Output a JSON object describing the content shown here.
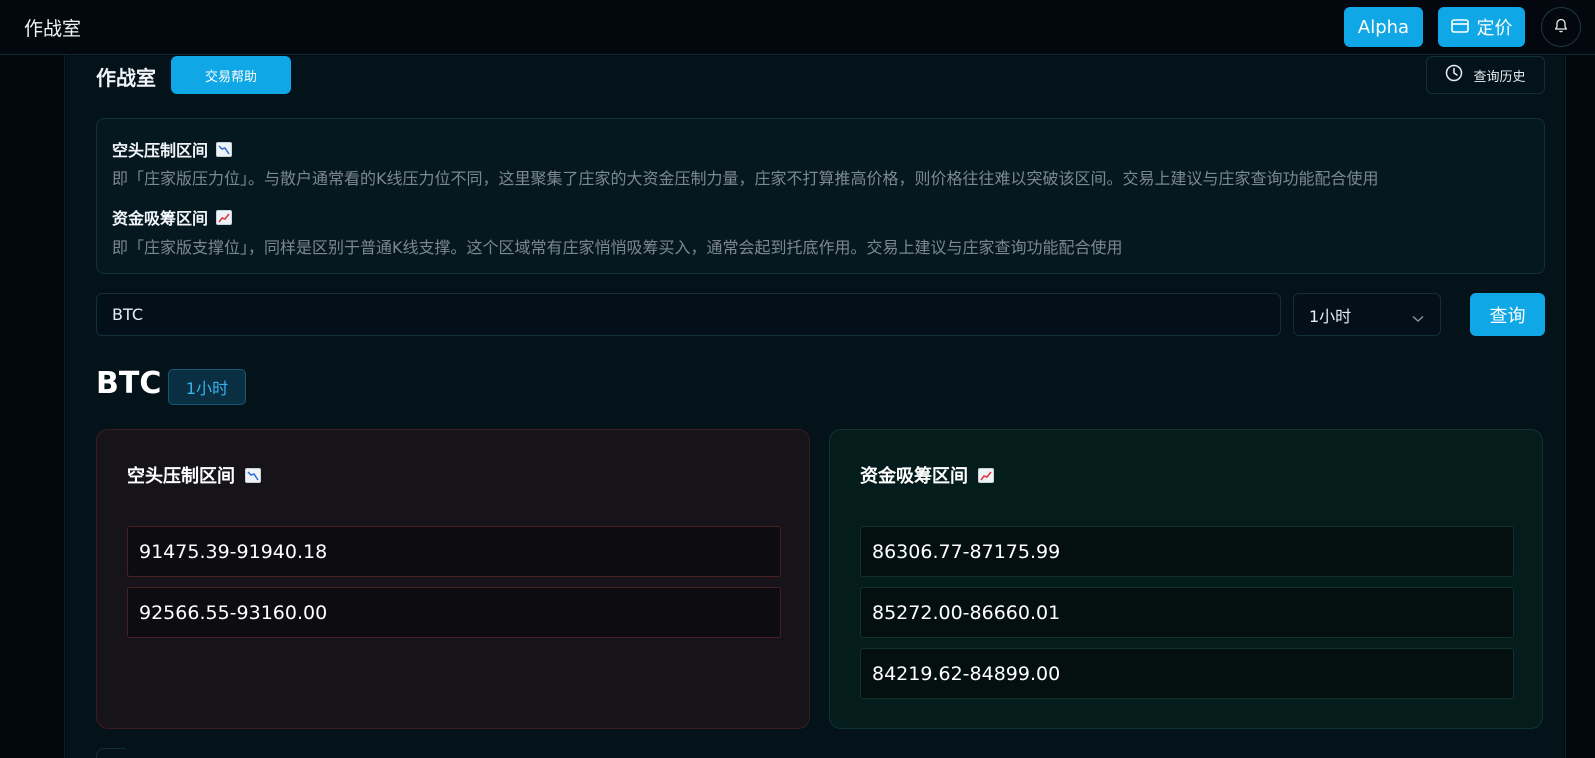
{
  "app": {
    "title": "作战室"
  },
  "topbar": {
    "alpha_label": "Alpha",
    "pricing_label": "定价"
  },
  "header": {
    "title": "作战室",
    "help_label": "交易帮助",
    "history_label": "查询历史"
  },
  "info": {
    "short_title": "空头压制区间",
    "short_desc": "即「庄家版压力位」。与散户通常看的K线压力位不同，这里聚集了庄家的大资金压制力量，庄家不打算推高价格，则价格往往难以突破该区间。交易上建议与庄家查询功能配合使用",
    "long_title": "资金吸筹区间",
    "long_desc": "即「庄家版支撑位」，同样是区别于普通K线支撑。这个区域常有庄家悄悄吸筹买入，通常会起到托底作用。交易上建议与庄家查询功能配合使用"
  },
  "query": {
    "symbol_value": "BTC",
    "interval_value": "1小时",
    "query_label": "查询"
  },
  "result": {
    "symbol": "BTC",
    "interval": "1小时",
    "short_card": {
      "title": "空头压制区间",
      "zones": [
        "91475.39-91940.18",
        "92566.55-93160.00"
      ]
    },
    "long_card": {
      "title": "资金吸筹区间",
      "zones": [
        "86306.77-87175.99",
        "85272.00-86660.01",
        "84219.62-84899.00"
      ]
    }
  },
  "icons": {
    "pricing": "card-icon",
    "bell": "bell-icon",
    "history": "clock-icon",
    "short": "chart-decreasing-icon",
    "long": "chart-increasing-icon",
    "select": "chevron-down-icon"
  },
  "colors": {
    "accent": "#10a7e6",
    "short_border": "#4a1f23",
    "long_border": "#123229",
    "badge_text": "#35b4ec"
  }
}
